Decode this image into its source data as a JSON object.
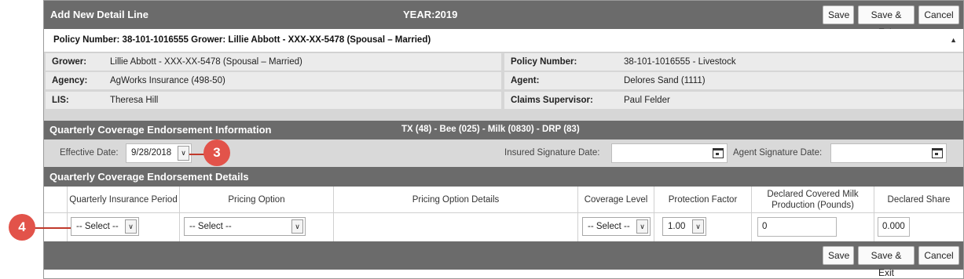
{
  "header": {
    "title": "Add New Detail Line",
    "year": "YEAR:2019",
    "save_label": "Save",
    "save_exit_label": "Save & Exit",
    "cancel_label": "Cancel"
  },
  "policy_strip": {
    "text": "Policy Number: 38-101-1016555 Grower: Lillie Abbott - XXX-XX-5478 (Spousal – Married)",
    "collapse_icon": "▲"
  },
  "info": {
    "grower_label": "Grower:",
    "grower_value": "Lillie Abbott - XXX-XX-5478 (Spousal – Married)",
    "policy_label": "Policy Number:",
    "policy_value": "38-101-1016555 - Livestock",
    "agency_label": "Agency:",
    "agency_value": "AgWorks Insurance (498-50)",
    "agent_label": "Agent:",
    "agent_value": "Delores Sand (1111)",
    "lis_label": "LIS:",
    "lis_value": "Theresa Hill",
    "supervisor_label": "Claims Supervisor:",
    "supervisor_value": "Paul Felder"
  },
  "qce": {
    "title": "Quarterly Coverage Endorsement Information",
    "subtitle": "TX (48) - Bee (025) - Milk (0830) - DRP (83)",
    "effective_date_label": "Effective Date:",
    "effective_date_value": "9/28/2018",
    "insured_sig_label": "Insured Signature Date:",
    "insured_sig_value": "",
    "agent_sig_label": "Agent Signature Date:",
    "agent_sig_value": ""
  },
  "details": {
    "title": "Quarterly Coverage Endorsement Details",
    "columns": [
      "Quarterly Insurance Period",
      "Pricing Option",
      "Pricing Option Details",
      "Coverage Level",
      "Protection Factor",
      "Declared Covered Milk Production (Pounds)",
      "Declared Share"
    ],
    "row": {
      "period": "-- Select --",
      "pricing": "-- Select --",
      "pricing_details": "",
      "coverage": "-- Select --",
      "protection": "1.00",
      "milk": "0",
      "share": "0.000"
    }
  },
  "footer": {
    "save_label": "Save",
    "save_exit_label": "Save & Exit",
    "cancel_label": "Cancel"
  },
  "callouts": {
    "three": "3",
    "four": "4"
  }
}
